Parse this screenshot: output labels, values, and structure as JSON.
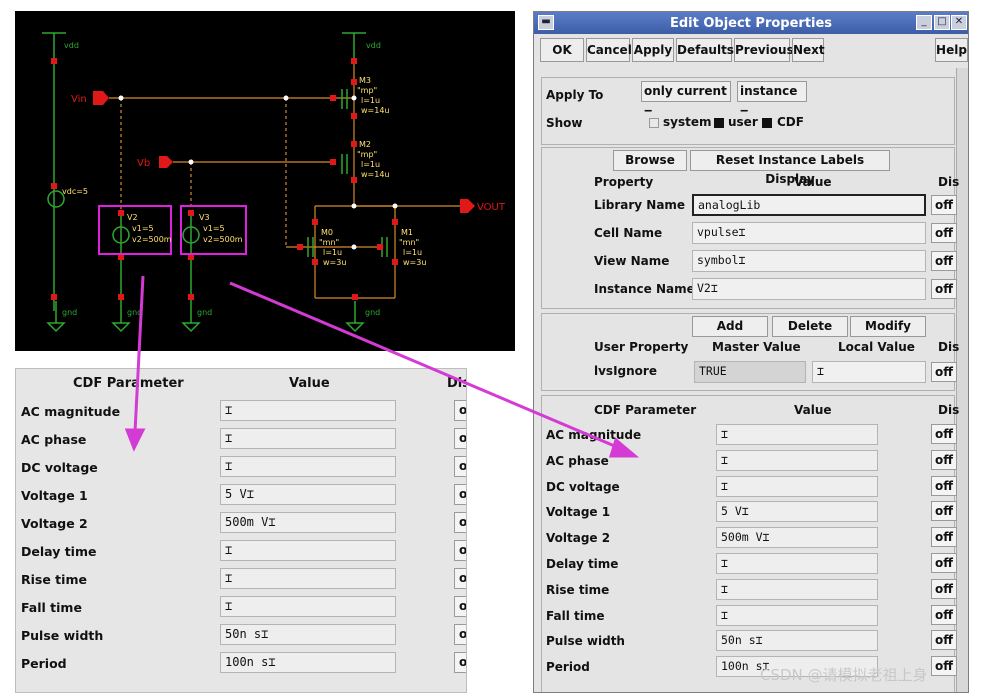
{
  "schematic": {
    "net_labels": {
      "vin": "Vin",
      "vb": "Vb",
      "vout": "VOUT"
    },
    "vdc_label": "vdc=5",
    "v2": {
      "name": "V2",
      "v1": "v1=5",
      "v2": "v2=500m"
    },
    "v3": {
      "name": "V3",
      "v1": "v1=5",
      "v2": "v2=500m"
    },
    "m3": {
      "name": "M3",
      "model": "\"mp\"",
      "l": "l=1u",
      "w": "w=14u"
    },
    "m2": {
      "name": "M2",
      "model": "\"mp\"",
      "l": "l=1u",
      "w": "w=14u"
    },
    "m0": {
      "name": "M0",
      "model": "\"mn\"",
      "l": "l=1u",
      "w": "w=3u"
    },
    "m1": {
      "name": "M1",
      "model": "\"mn\"",
      "l": "l=1u",
      "w": "w=3u"
    },
    "vdd": "vdd",
    "gnd": "gnd"
  },
  "left_panel": {
    "header_param": "CDF Parameter",
    "header_value": "Value",
    "header_display": "Dis",
    "off_label": "off",
    "rows": [
      {
        "label": "AC magnitude",
        "value": ""
      },
      {
        "label": "AC phase",
        "value": ""
      },
      {
        "label": "DC voltage",
        "value": ""
      },
      {
        "label": "Voltage 1",
        "value": "5 V"
      },
      {
        "label": "Voltage 2",
        "value": "500m V"
      },
      {
        "label": "Delay time",
        "value": ""
      },
      {
        "label": "Rise time",
        "value": ""
      },
      {
        "label": "Fall time",
        "value": ""
      },
      {
        "label": "Pulse width",
        "value": "50n s"
      },
      {
        "label": "Period",
        "value": "100n s"
      }
    ]
  },
  "dialog": {
    "title": "Edit Object Properties",
    "toolbar": {
      "ok": "OK",
      "cancel": "Cancel",
      "apply": "Apply",
      "defaults": "Defaults",
      "previous": "Previous",
      "next": "Next",
      "help": "Help"
    },
    "apply_to_label": "Apply To",
    "apply_to_value": "only current",
    "apply_to_type": "instance",
    "show_label": "Show",
    "show_system": "system",
    "show_user": "user",
    "show_cdf": "CDF",
    "browse": "Browse",
    "reset_labels": "Reset Instance Labels Display",
    "property_header": "Property",
    "value_header": "Value",
    "display_header": "Dis",
    "off_label": "off",
    "properties": [
      {
        "label": "Library Name",
        "value": "analogLib"
      },
      {
        "label": "Cell Name",
        "value": "vpulse"
      },
      {
        "label": "View Name",
        "value": "symbol"
      },
      {
        "label": "Instance Name",
        "value": "V2"
      }
    ],
    "add": "Add",
    "delete": "Delete",
    "modify": "Modify",
    "user_property_header": "User Property",
    "master_value_header": "Master Value",
    "local_value_header": "Local Value",
    "user_props": [
      {
        "label": "lvsIgnore",
        "master": "TRUE",
        "local": ""
      }
    ],
    "cdf_param_header": "CDF Parameter",
    "cdf_rows": [
      {
        "label": "AC magnitude",
        "value": ""
      },
      {
        "label": "AC phase",
        "value": ""
      },
      {
        "label": "DC voltage",
        "value": ""
      },
      {
        "label": "Voltage 1",
        "value": "5 V"
      },
      {
        "label": "Voltage 2",
        "value": "500m V"
      },
      {
        "label": "Delay time",
        "value": ""
      },
      {
        "label": "Rise time",
        "value": ""
      },
      {
        "label": "Fall time",
        "value": ""
      },
      {
        "label": "Pulse width",
        "value": "50n s"
      },
      {
        "label": "Period",
        "value": "100n s"
      }
    ]
  },
  "watermark": "CSDN @请模拟老祖上身",
  "colors": {
    "schematic_bg": "#000000",
    "wire": "#d88a2a",
    "pin": "#e01818",
    "ground": "#2fa82f",
    "highlight": "#e020e0",
    "arrow": "#d43ad4"
  }
}
